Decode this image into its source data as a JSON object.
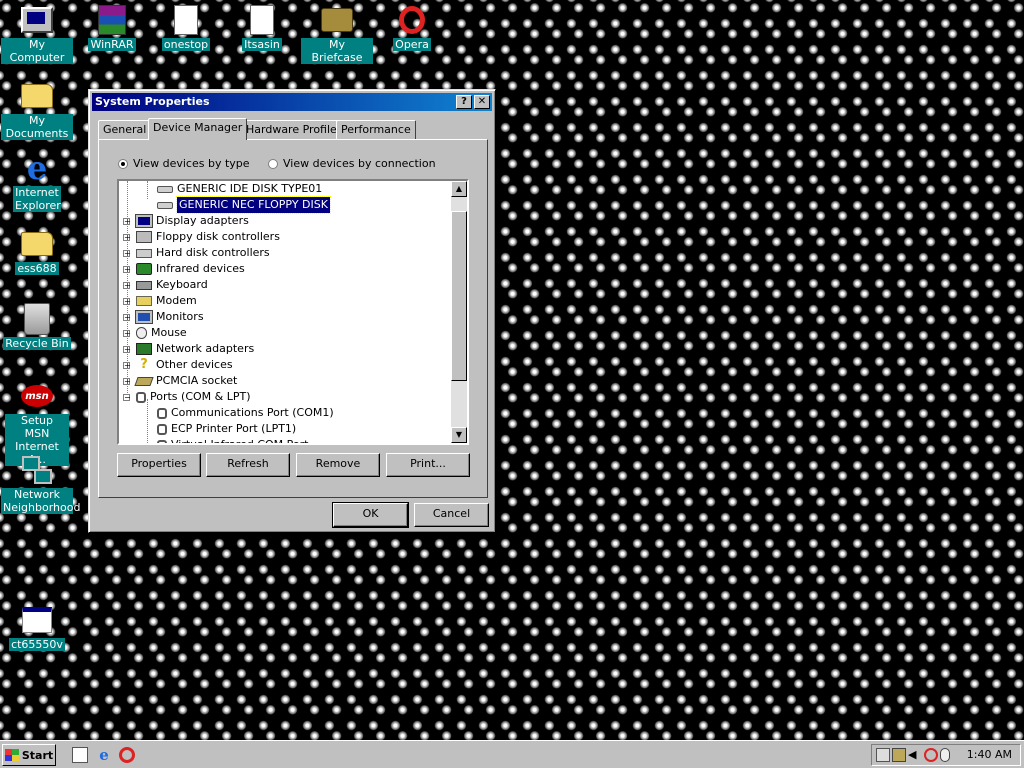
{
  "desktop": {
    "icons": [
      {
        "label": "My Computer"
      },
      {
        "label": "WinRAR"
      },
      {
        "label": "onestop"
      },
      {
        "label": "Itsasin"
      },
      {
        "label": "My Briefcase"
      },
      {
        "label": "Opera"
      },
      {
        "label": "My Documents"
      },
      {
        "label": "Internet Explorer"
      },
      {
        "label": "ess688"
      },
      {
        "label": "Recycle Bin"
      },
      {
        "label": "Setup MSN Internet A..."
      },
      {
        "label": "Network Neighborhood"
      },
      {
        "label": "ct65550v"
      }
    ]
  },
  "dialog": {
    "title": "System Properties",
    "help_btn": "?",
    "close_btn": "✕",
    "tabs": [
      {
        "label": "General"
      },
      {
        "label": "Device Manager"
      },
      {
        "label": "Hardware Profiles"
      },
      {
        "label": "Performance"
      }
    ],
    "active_tab": "Device Manager",
    "view_by_type": "View devices by type",
    "view_by_connection": "View devices by connection",
    "view_selected": "type",
    "tree": [
      {
        "label": "GENERIC IDE  DISK TYPE01",
        "level": 2,
        "icon": "disk-icon"
      },
      {
        "label": "GENERIC NEC  FLOPPY DISK",
        "level": 2,
        "icon": "disk-icon",
        "selected": true
      },
      {
        "label": "Display adapters",
        "level": 1,
        "icon": "display-adapter-icon"
      },
      {
        "label": "Floppy disk controllers",
        "level": 1,
        "icon": "floppy-controller-icon"
      },
      {
        "label": "Hard disk controllers",
        "level": 1,
        "icon": "hard-disk-controller-icon"
      },
      {
        "label": "Infrared devices",
        "level": 1,
        "icon": "infrared-icon"
      },
      {
        "label": "Keyboard",
        "level": 1,
        "icon": "keyboard-icon"
      },
      {
        "label": "Modem",
        "level": 1,
        "icon": "modem-icon"
      },
      {
        "label": "Monitors",
        "level": 1,
        "icon": "monitor-icon"
      },
      {
        "label": "Mouse",
        "level": 1,
        "icon": "mouse-icon"
      },
      {
        "label": "Network adapters",
        "level": 1,
        "icon": "network-adapter-icon"
      },
      {
        "label": "Other devices",
        "level": 1,
        "icon": "question-icon"
      },
      {
        "label": "PCMCIA socket",
        "level": 1,
        "icon": "pcmcia-icon"
      },
      {
        "label": "Ports (COM & LPT)",
        "level": 1,
        "icon": "port-icon",
        "expanded": true
      },
      {
        "label": "Communications Port (COM1)",
        "level": 2,
        "icon": "port-icon"
      },
      {
        "label": "ECP Printer Port (LPT1)",
        "level": 2,
        "icon": "port-icon"
      },
      {
        "label": "Virtual Infrared COM Port",
        "level": 2,
        "icon": "port-icon"
      }
    ],
    "buttons": {
      "properties": "Properties",
      "refresh": "Refresh",
      "remove": "Remove",
      "print": "Print...",
      "ok": "OK",
      "cancel": "Cancel"
    }
  },
  "taskbar": {
    "start_label": "Start",
    "clock": "1:40 AM"
  }
}
